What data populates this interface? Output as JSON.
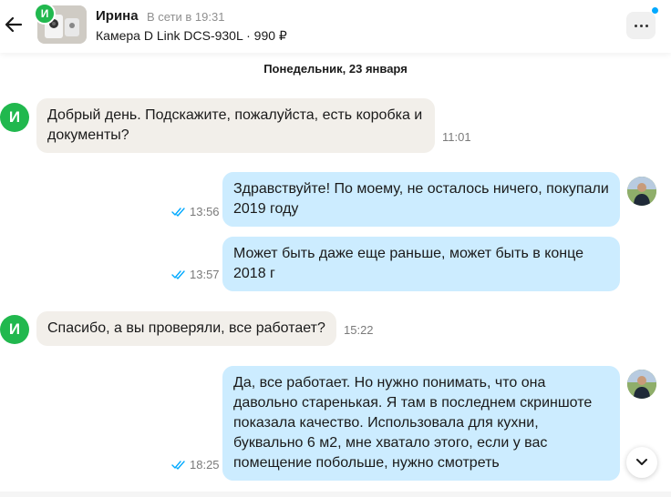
{
  "header": {
    "name": "Ирина",
    "status": "В сети в 19:31",
    "product": "Камера D Link DCS-930L · 990 ₽",
    "avatar_letter": "И"
  },
  "date_separator": "Понедельник, 23 января",
  "messages": [
    {
      "from": "in",
      "text": "Добрый день. Подскажите, пожалуйста, есть коробка и документы?",
      "time": "11:01",
      "avatar": "И"
    },
    {
      "from": "out",
      "text": "Здравствуйте! По моему, не осталось ничего, покупали 2019 году",
      "time": "13:56",
      "read": true
    },
    {
      "from": "out",
      "text": "Может быть даже еще раньше, может быть в конце 2018 г",
      "time": "13:57",
      "read": true
    },
    {
      "from": "in",
      "text": "Спасибо, а вы проверяли, все работает?",
      "time": "15:22",
      "avatar": "И"
    },
    {
      "from": "out",
      "text": "Да, все работает. Но нужно понимать, что она давольно старенькая. Я там в последнем скриншоте показала качество. Использовала для кухни, буквально 6 м2, мне хватало этого, если у вас помещение побольше, нужно смотреть",
      "time": "18:25",
      "read": true
    }
  ],
  "colors": {
    "incoming_bubble": "#f2efea",
    "outgoing_bubble": "#ccecff",
    "avatar_green": "#21b84e",
    "read_check": "#00a9ff"
  }
}
